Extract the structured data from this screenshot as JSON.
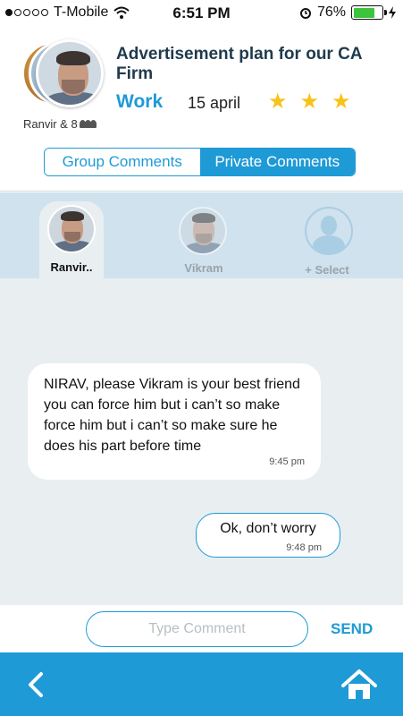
{
  "status_bar": {
    "carrier": "T-Mobile",
    "time": "6:51 PM",
    "battery_text": "76%",
    "battery_level": 0.76
  },
  "header": {
    "title": "Advertisement plan for our CA Firm",
    "category": "Work",
    "date": "15 april",
    "rating_stars": 3,
    "members_text": "Ranvir & 8",
    "icons": [
      "group-avatars",
      "people-icon"
    ]
  },
  "segments": {
    "group_label": "Group Comments",
    "private_label": "Private Comments",
    "selected": "Private Comments"
  },
  "participants": {
    "items": [
      {
        "name": "Ranvir..",
        "active": true
      },
      {
        "name": "Vikram",
        "active": false
      },
      {
        "name": "+ Select",
        "active": false
      }
    ]
  },
  "messages": [
    {
      "text": "NIRAV, please Vikram is your best friend you can force him but i can’t so make  force him but i can’t so make sure he does his part before time",
      "time": "9:45 pm",
      "direction": "incoming"
    },
    {
      "text": "Ok, don’t worry",
      "time": "9:48 pm",
      "direction": "outgoing"
    }
  ],
  "composer": {
    "placeholder": "Type Comment",
    "value": "",
    "send_label": "SEND"
  },
  "colors": {
    "accent": "#1e9ad6",
    "star": "#f7c21a",
    "chat_bg": "#e9eef1",
    "strip_bg": "#cfe2ee"
  }
}
